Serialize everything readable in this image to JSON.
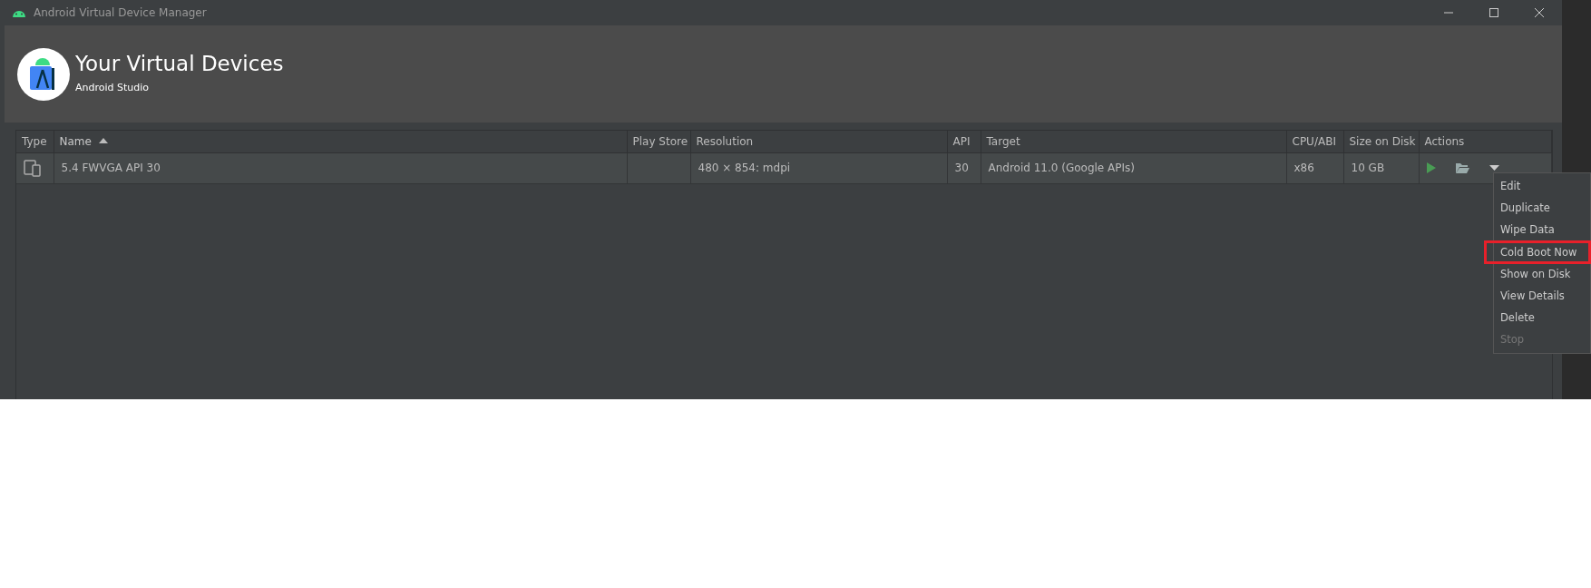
{
  "window": {
    "title": "Android Virtual Device Manager"
  },
  "header": {
    "title": "Your Virtual Devices",
    "subtitle": "Android Studio"
  },
  "table": {
    "columns": [
      {
        "label": "Type",
        "sorted": false
      },
      {
        "label": "Name",
        "sorted": true
      },
      {
        "label": "Play Store",
        "sorted": false
      },
      {
        "label": "Resolution",
        "sorted": false
      },
      {
        "label": "API",
        "sorted": false
      },
      {
        "label": "Target",
        "sorted": false
      },
      {
        "label": "CPU/ABI",
        "sorted": false
      },
      {
        "label": "Size on Disk",
        "sorted": false
      },
      {
        "label": "Actions",
        "sorted": false
      }
    ],
    "rows": [
      {
        "name": "5.4  FWVGA API 30",
        "resolution": "480 × 854: mdpi",
        "api": "30",
        "target": "Android 11.0 (Google APIs)",
        "cpu": "x86",
        "size": "10 GB"
      }
    ]
  },
  "menu": {
    "items": [
      {
        "label": "Edit",
        "disabled": false,
        "highlighted": false
      },
      {
        "label": "Duplicate",
        "disabled": false,
        "highlighted": false
      },
      {
        "label": "Wipe Data",
        "disabled": false,
        "highlighted": false
      },
      {
        "label": "Cold Boot Now",
        "disabled": false,
        "highlighted": true
      },
      {
        "label": "Show on Disk",
        "disabled": false,
        "highlighted": false
      },
      {
        "label": "View Details",
        "disabled": false,
        "highlighted": false
      },
      {
        "label": "Delete",
        "disabled": false,
        "highlighted": false
      },
      {
        "label": "Stop",
        "disabled": true,
        "highlighted": false
      }
    ]
  }
}
